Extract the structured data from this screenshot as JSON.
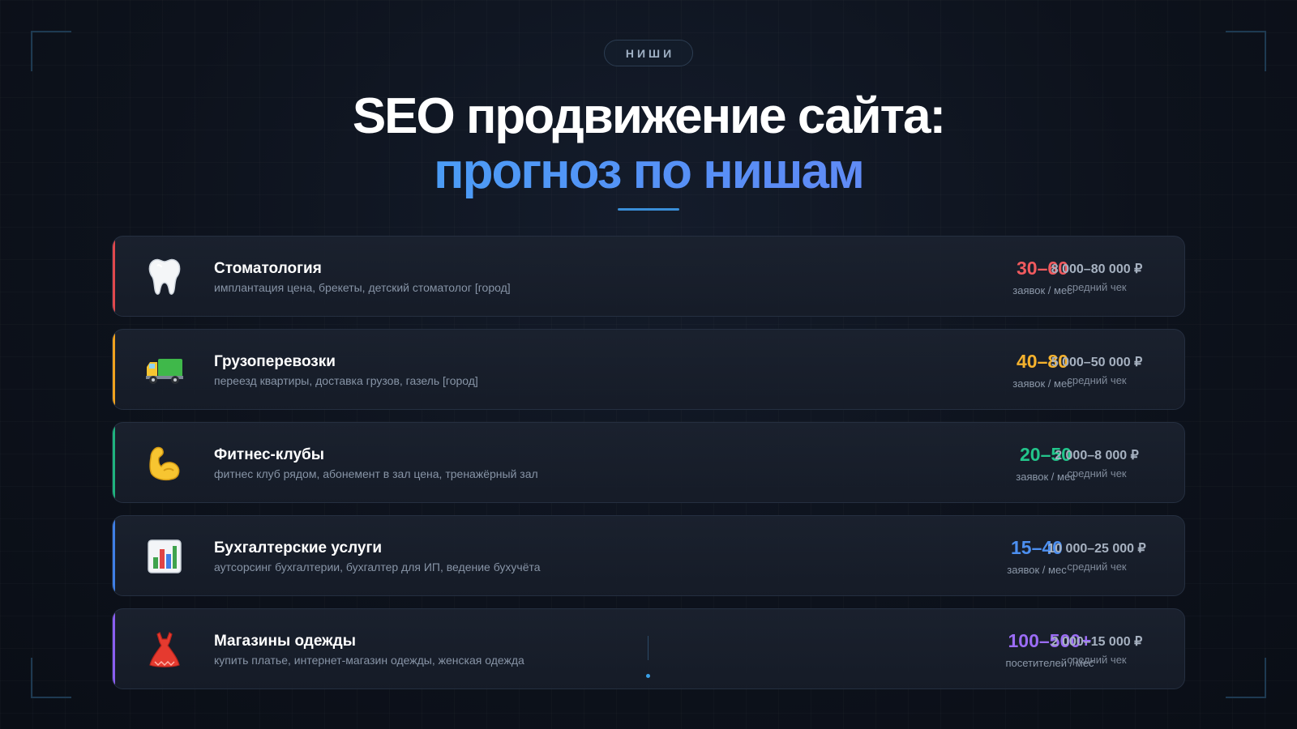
{
  "badge": "НИШИ",
  "title_line1": "SEO продвижение сайта:",
  "title_line2": "прогноз по нишам",
  "niches": [
    {
      "name": "Стоматология",
      "keywords": "имплантация цена, брекеты, детский стоматолог [город]",
      "leads": "30–60",
      "leads_label": "заявок / мес",
      "check": "8 000–80 000 ₽",
      "check_label": "средний чек",
      "color": "#f05a5e",
      "icon": "tooth-icon"
    },
    {
      "name": "Грузоперевозки",
      "keywords": "переезд квартиры, доставка грузов, газель [город]",
      "leads": "40–80",
      "leads_label": "заявок / мес",
      "check": "5 000–50 000 ₽",
      "check_label": "средний чек",
      "color": "#f5b22d",
      "icon": "truck-icon"
    },
    {
      "name": "Фитнес-клубы",
      "keywords": "фитнес клуб рядом, абонемент в зал цена, тренажёрный зал",
      "leads": "20–50",
      "leads_label": "заявок / мес",
      "check": "2 000–8 000 ₽",
      "check_label": "средний чек",
      "color": "#23c58b",
      "icon": "flexed-biceps-icon"
    },
    {
      "name": "Бухгалтерские услуги",
      "keywords": "аутсорсинг бухгалтерии, бухгалтер для ИП, ведение бухучёта",
      "leads": "15–40",
      "leads_label": "заявок / мес",
      "check": "10 000–25 000 ₽",
      "check_label": "средний чек",
      "color": "#4c8ff0",
      "icon": "bar-chart-icon"
    },
    {
      "name": "Магазины одежды",
      "keywords": "купить платье, интернет-магазин одежды, женская одежда",
      "leads": "100–500+",
      "leads_label": "посетителей / мес",
      "check": "2 000–15 000 ₽",
      "check_label": "средний чек",
      "color": "#9b6cf5",
      "icon": "dress-icon"
    }
  ]
}
